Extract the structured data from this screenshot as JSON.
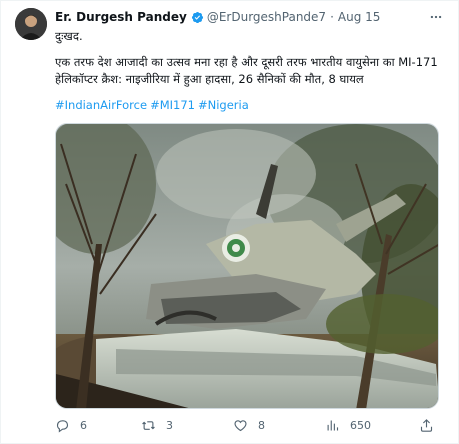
{
  "tweet": {
    "display_name": "Er. Durgesh Pandey",
    "handle": "@ErDurgeshPande7",
    "separator": "·",
    "date": "Aug 15",
    "paragraphs": [
      "दुःखद.",
      "एक तरफ देश आजादी का उत्सव मना रहा है और दूसरी तरफ भारतीय वायुसेना का MI-171 हेलिकॉप्टर क्रैश: नाइजीरिया में हुआ हादसा, 26 सैनिकों की मौत, 8 घायल"
    ],
    "hashtags": [
      "#IndianAirForce",
      "#MI171",
      "#Nigeria"
    ],
    "colors": {
      "link": "#1d9bf0",
      "verified": "#1d9bf0",
      "secondary_text": "#536471"
    }
  },
  "actions": {
    "reply_count": "6",
    "retweet_count": "3",
    "like_count": "8",
    "views_count": "650"
  },
  "icons": {
    "verified": "verified-badge-icon",
    "more": "more-icon",
    "reply": "reply-icon",
    "retweet": "retweet-icon",
    "like": "like-icon",
    "views": "views-icon",
    "share": "share-icon"
  }
}
